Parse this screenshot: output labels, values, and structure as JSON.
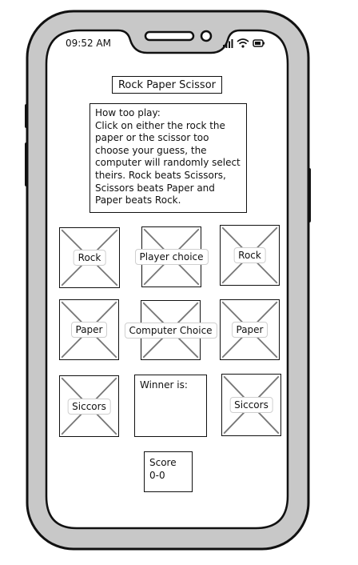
{
  "status_bar": {
    "time": "09:52 AM"
  },
  "header": {
    "title": "Rock Paper Scissor"
  },
  "instructions": {
    "heading": "How too play:",
    "body": "Click on either the rock the paper or the scissor too choose your guess, the computer will randomly select theirs. Rock beats Scissors, Scissors beats Paper and Paper beats Rock."
  },
  "grid": {
    "row1": {
      "left": "Rock",
      "center": "Player choice",
      "right": "Rock"
    },
    "row2": {
      "left": "Paper",
      "center": "Computer Choice",
      "right": "Paper"
    },
    "row3": {
      "left": "Siccors",
      "right": "Siccors"
    }
  },
  "winner": {
    "label": "Winner is:"
  },
  "score": {
    "label": "Score",
    "value": "0-0"
  },
  "colors": {
    "stroke": "#111111",
    "phone_frame": "#c8c8c8",
    "screen": "#ffffff"
  }
}
